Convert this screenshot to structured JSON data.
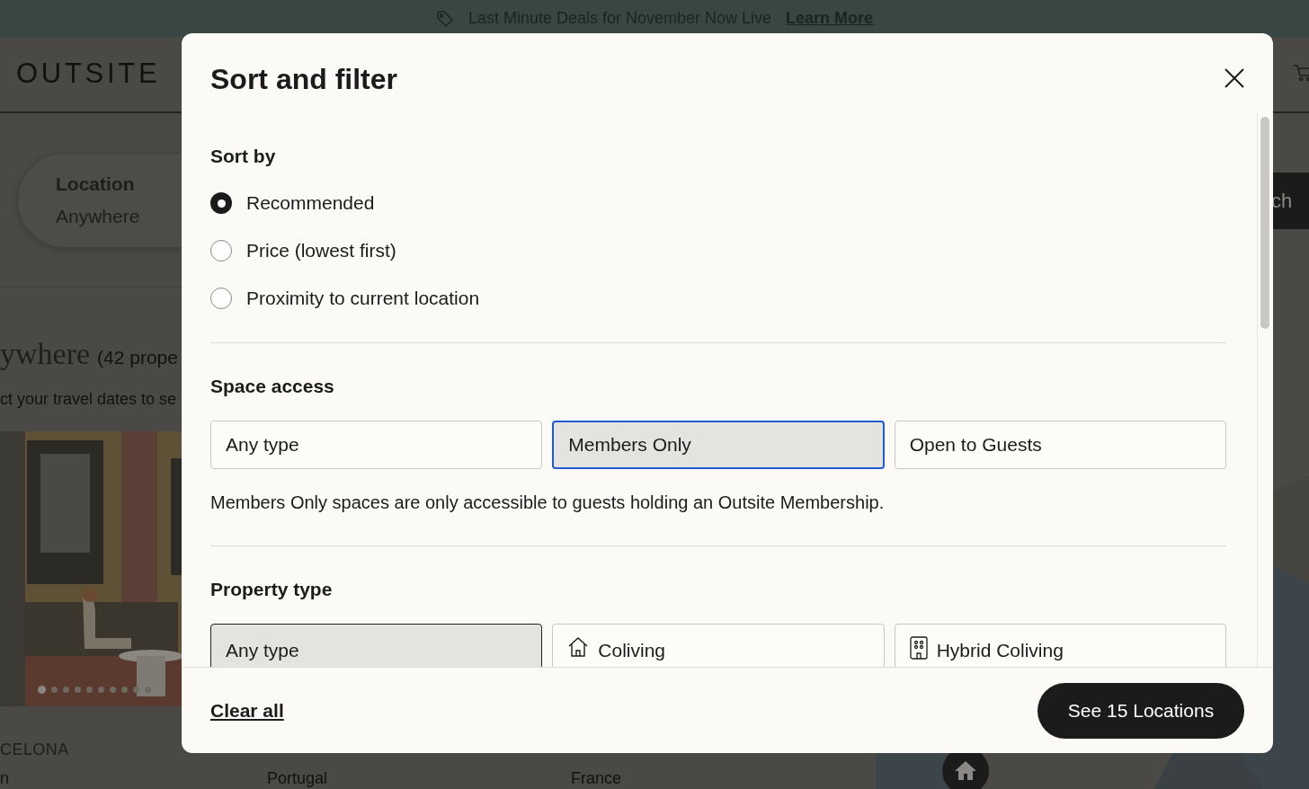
{
  "banner": {
    "text": "Last Minute Deals for November Now Live",
    "link": "Learn More"
  },
  "background": {
    "logo": "OUTSITE",
    "search": {
      "label": "Location",
      "value": "Anywhere",
      "button": "ch"
    },
    "heading": "ywhere",
    "count": "(42 prope",
    "hint": "ct your travel dates to se",
    "listings": [
      {
        "title": "CELONA",
        "subtitle": "n",
        "slides": [
          {
            "selected": true
          },
          {
            "selected": false
          },
          {
            "selected": false
          },
          {
            "selected": false
          },
          {
            "selected": false
          },
          {
            "selected": false
          },
          {
            "selected": false
          },
          {
            "selected": false
          },
          {
            "selected": false
          },
          {
            "selected": false
          }
        ]
      },
      {
        "subtitle": "Portugal"
      },
      {
        "subtitle": "France"
      }
    ]
  },
  "modal": {
    "title": "Sort and filter",
    "sort_by": {
      "heading": "Sort by",
      "options": [
        {
          "label": "Recommended",
          "selected": true
        },
        {
          "label": "Price (lowest first)",
          "selected": false
        },
        {
          "label": "Proximity to current location",
          "selected": false
        }
      ]
    },
    "space_access": {
      "heading": "Space access",
      "options": [
        {
          "label": "Any type",
          "selected": false,
          "focused": false
        },
        {
          "label": "Members Only",
          "selected": true,
          "focused": true
        },
        {
          "label": "Open to Guests",
          "selected": false,
          "focused": false
        }
      ],
      "note": "Members Only spaces are only accessible to guests holding an Outsite Membership."
    },
    "property_type": {
      "heading": "Property type",
      "options": [
        {
          "label": "Any type",
          "selected": true,
          "kind": "plain"
        },
        {
          "label": "Coliving",
          "selected": false,
          "kind": "house"
        },
        {
          "label": "Hybrid Coliving",
          "selected": false,
          "kind": "building"
        }
      ]
    },
    "footer": {
      "clear": "Clear all",
      "submit": "See 15 Locations"
    }
  }
}
